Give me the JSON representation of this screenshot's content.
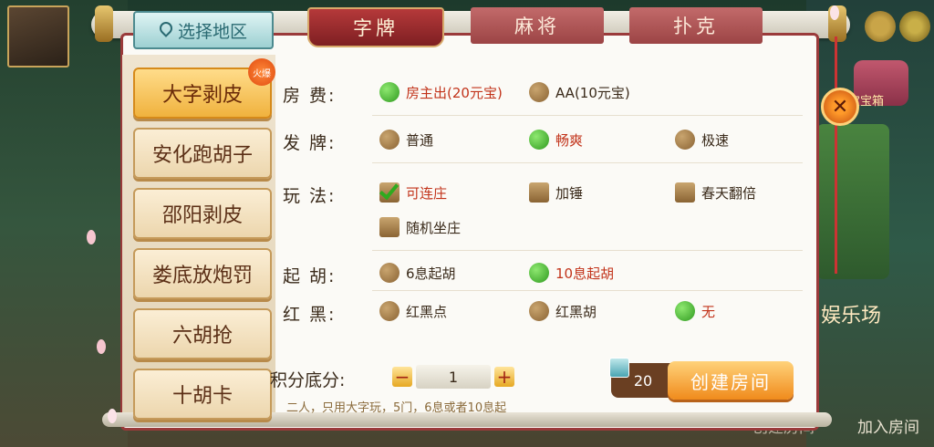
{
  "region_button": {
    "label": "选择地区"
  },
  "tabs": [
    {
      "label": "字牌",
      "active": true
    },
    {
      "label": "麻将",
      "active": false
    },
    {
      "label": "扑克",
      "active": false
    }
  ],
  "games": [
    {
      "label": "大字剥皮",
      "active": true,
      "badge": "火爆"
    },
    {
      "label": "安化跑胡子",
      "active": false
    },
    {
      "label": "邵阳剥皮",
      "active": false
    },
    {
      "label": "娄底放炮罚",
      "active": false
    },
    {
      "label": "六胡抢",
      "active": false
    },
    {
      "label": "十胡卡",
      "active": false
    }
  ],
  "options": {
    "room_fee": {
      "label": "房  费:",
      "choices": [
        {
          "text": "房主出(20元宝)",
          "selected": true
        },
        {
          "text": "AA(10元宝)",
          "selected": false
        }
      ]
    },
    "deal": {
      "label": "发  牌:",
      "choices": [
        {
          "text": "普通",
          "selected": false
        },
        {
          "text": "畅爽",
          "selected": true
        },
        {
          "text": "极速",
          "selected": false
        }
      ]
    },
    "play": {
      "label": "玩  法:",
      "choices": [
        {
          "text": "可连庄",
          "selected": true
        },
        {
          "text": "加锤",
          "selected": false
        },
        {
          "text": "春天翻倍",
          "selected": false
        },
        {
          "text": "随机坐庄",
          "selected": false
        }
      ]
    },
    "start_hu": {
      "label": "起  胡:",
      "choices": [
        {
          "text": "6息起胡",
          "selected": false
        },
        {
          "text": "10息起胡",
          "selected": true
        }
      ]
    },
    "red_black": {
      "label": "红  黑:",
      "choices": [
        {
          "text": "红黑点",
          "selected": false
        },
        {
          "text": "红黑胡",
          "selected": false
        },
        {
          "text": "无",
          "selected": true
        }
      ]
    }
  },
  "score": {
    "label": "积分底分:",
    "value": "1",
    "minus": "−",
    "plus": "+"
  },
  "description": "二人，只用大字玩，5门，6息或者10息起",
  "cost": "20",
  "create_button": {
    "label": "创建房间"
  },
  "close_button": {
    "label": "✕"
  },
  "background": {
    "treasure_label": "宝宝箱",
    "joy_label": "娱乐场",
    "join_room": "加入房间",
    "create_room": "创建房间"
  }
}
